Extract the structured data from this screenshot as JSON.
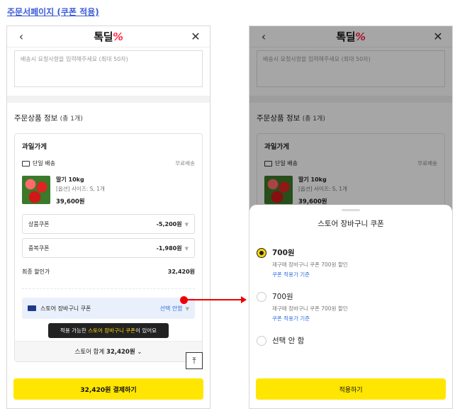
{
  "page_title": "주문서페이지 (쿠폰 적용)",
  "logo": {
    "text": "톡딜",
    "mark": "%"
  },
  "memo_placeholder": "배송시 요청사항을 입력해주세요 (최대 50자)",
  "section": {
    "title": "주문상품 정보",
    "count": "(총 1개)"
  },
  "store": {
    "name": "과일가게",
    "shipping_label": "단일 배송",
    "shipping_fee": "무료배송",
    "product": {
      "name": "딸기 10kg",
      "option": "[옵션] 사이즈: S, 1개",
      "price": "39,600원"
    },
    "coupons": [
      {
        "label": "상품쿠폰",
        "value": "-5,200원"
      },
      {
        "label": "중복쿠폰",
        "value": "-1,980원"
      }
    ],
    "final_label": "최종 할인가",
    "final_value": "32,420원",
    "basket_label": "스토어 장바구니 쿠폰",
    "basket_select": "선택 안함",
    "tooltip": {
      "pre": "적용 가능한 ",
      "highlight": "스토어 장바구니 쿠폰",
      "post": "이 있어요"
    },
    "total_label": "스토어 합계",
    "total_value": "32,420원"
  },
  "pay_button": "32,420원 결제하기",
  "sheet": {
    "title": "스토어 장바구니 쿠폰",
    "options": [
      {
        "amount": "700원",
        "desc": "재구매 장바구니 쿠폰 700원 할인",
        "link": "쿠폰 적용가 기준",
        "selected": true
      },
      {
        "amount": "700원",
        "desc": "재구매 장바구니 쿠폰 700원 할인",
        "link": "쿠폰 적용가 기준",
        "selected": false
      },
      {
        "amount": "선택 안 함",
        "selected": false
      }
    ],
    "apply_button": "적용하기"
  }
}
